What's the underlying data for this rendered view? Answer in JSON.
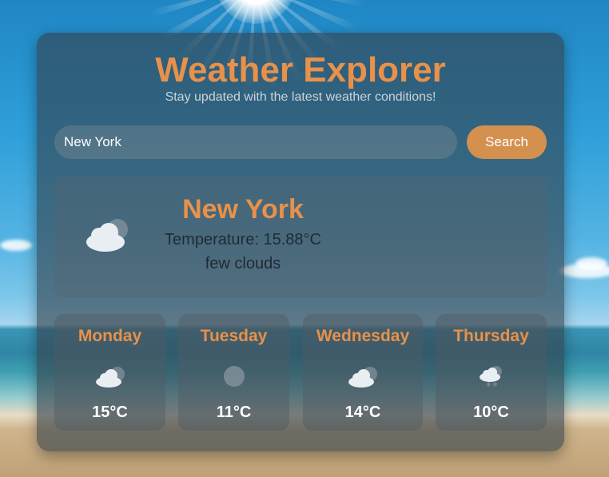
{
  "header": {
    "title": "Weather Explorer",
    "subtitle": "Stay updated with the latest weather conditions!"
  },
  "search": {
    "value": "New York",
    "button_label": "Search"
  },
  "current": {
    "city": "New York",
    "temperature_label": "Temperature:",
    "temperature_value": "15.88°C",
    "description": "few clouds",
    "icon": "few-clouds-icon"
  },
  "forecast": [
    {
      "day": "Monday",
      "temp": "15°C",
      "icon": "few-clouds-icon"
    },
    {
      "day": "Tuesday",
      "temp": "11°C",
      "icon": "clear-sky-icon"
    },
    {
      "day": "Wednesday",
      "temp": "14°C",
      "icon": "few-clouds-icon"
    },
    {
      "day": "Thursday",
      "temp": "10°C",
      "icon": "snow-icon"
    }
  ],
  "colors": {
    "accent": "#e8914a",
    "button": "#d4904f",
    "panel": "#34404a"
  }
}
